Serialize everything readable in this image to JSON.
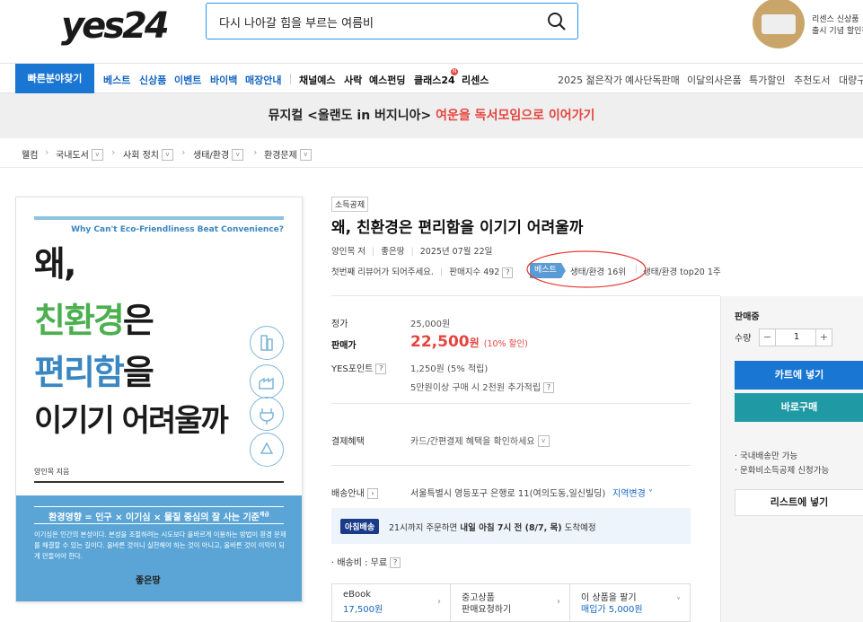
{
  "header": {
    "logo": "yes24",
    "search_value": "다시 나아갈 힘을 부르는 여름비",
    "ad_line1": "리센스 신상품",
    "ad_line2": "출시 기념 할인전"
  },
  "nav": {
    "quick_find": "빠른분야찾기",
    "left_items": [
      "베스트",
      "신상품",
      "이벤트",
      "바이백",
      "매장안내"
    ],
    "mid_items": [
      "채널예스",
      "사락",
      "예스펀딩",
      "클래스24",
      "리센스"
    ],
    "class_badge": "N",
    "right_items": [
      "2025 젊은작가",
      "예사단독판매",
      "이달의사은품",
      "특가할인",
      "추천도서",
      "대량구매"
    ]
  },
  "banner": {
    "part1": "뮤지컬 <올랜도 in 버지니아>",
    "part2": "여운을 독서모임으로 이어가기"
  },
  "breadcrumb": [
    "웰컴",
    "국내도서",
    "사회 정치",
    "생태/환경",
    "환경문제"
  ],
  "cover": {
    "subtitle": "Why Can't Eco-Friendliness Beat Convenience?",
    "line1": "왜,",
    "line2a": "친환경",
    "line2b": "은",
    "line3a": "편리함",
    "line3b": "을",
    "line4": "이기기 어려울까",
    "author": "양인목 지음",
    "tagline": "환경영향 = 인구 × 이기심 × 물질 중심의 잘 사는 기준",
    "tagline_sup": "제곱",
    "description": "이기심은 인간의 본성이다. 본성을 조절하려는 시도보다 올바르게 이용하는 방법이 환경 문제를 해결할 수 있는 길이다. 올바른 것이니 실천해야 하는 것이 아니고, 올바른 것이 이익이 되게 만들어야 한다.",
    "publisher": "좋은땅"
  },
  "product": {
    "badge": "소득공제",
    "title": "왜, 친환경은 편리함을 이기기 어려울까",
    "author": "양인목 저",
    "publisher": "좋은땅",
    "date": "2025년 07월 22일",
    "review_prompt": "첫번째 리뷰어가 되어주세요.",
    "sales_index": "판매지수 492",
    "best_badge": "베스트",
    "rank1": "생태/환경 16위",
    "rank2": "생태/환경 top20 1주"
  },
  "price": {
    "list_label": "정가",
    "list_price": "25,000원",
    "sale_label": "판매가",
    "sale_price": "22,500",
    "sale_unit": "원",
    "discount": "(10% 할인)",
    "point_label": "YES포인트",
    "point_value": "1,250원 (5% 적립)",
    "point_extra": "5만원이상 구매 시 2천원 추가적립"
  },
  "payment": {
    "label": "결제혜택",
    "value": "카드/간편결제 혜택을 확인하세요"
  },
  "shipping": {
    "label": "배송안내",
    "address": "서울특별시 영등포구 은행로 11(여의도동,일신빌딩)",
    "change": "지역변경",
    "badge": "아침배송",
    "notice_pre": "21시까지 주문하면",
    "notice_bold": "내일 아침 7시 전 (8/7, 목)",
    "notice_post": "도착예정",
    "fee": "배송비 : 무료"
  },
  "bottom_tabs": [
    {
      "title": "eBook",
      "value": "17,500원"
    },
    {
      "title": "중고상품",
      "value": "판매요청하기"
    },
    {
      "title": "이 상품을 팔기",
      "value": "매입가 5,000원"
    }
  ],
  "side": {
    "status": "판매중",
    "qty_label": "수량",
    "qty": "1",
    "cart": "카트에 넣기",
    "buy": "바로구매",
    "note1": "국내배송만 가능",
    "note2": "문화비소득공제 신청가능",
    "list": "리스트에 넣기"
  },
  "colors": {
    "accent": "#1976d2",
    "sale": "#e5453f",
    "buy": "#1f9aa5",
    "cover_green": "#4caf50",
    "cover_blue": "#3a86c0"
  }
}
